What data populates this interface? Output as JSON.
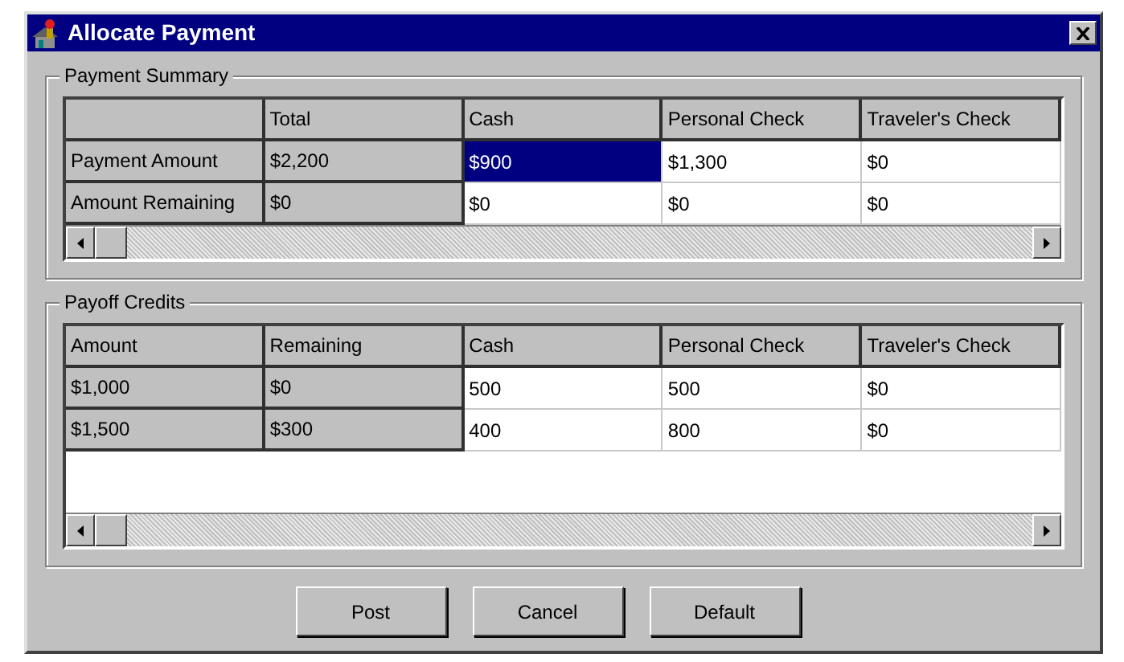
{
  "window": {
    "title": "Allocate Payment"
  },
  "payment_summary": {
    "title": "Payment Summary",
    "columns": [
      "",
      "Total",
      "Cash",
      "Personal Check",
      "Traveler's Check"
    ],
    "rows": [
      {
        "cells": [
          {
            "text": "Payment Amount",
            "kind": "fixed",
            "selected": false
          },
          {
            "text": "$2,200",
            "kind": "fixed",
            "selected": false
          },
          {
            "text": "$900",
            "kind": "edit",
            "selected": true
          },
          {
            "text": "$1,300",
            "kind": "edit",
            "selected": false
          },
          {
            "text": "$0",
            "kind": "edit",
            "selected": false
          }
        ]
      },
      {
        "cells": [
          {
            "text": "Amount Remaining",
            "kind": "fixed",
            "selected": false
          },
          {
            "text": "$0",
            "kind": "fixed",
            "selected": false
          },
          {
            "text": "$0",
            "kind": "edit",
            "selected": false
          },
          {
            "text": "$0",
            "kind": "edit",
            "selected": false
          },
          {
            "text": "$0",
            "kind": "edit",
            "selected": false
          }
        ]
      }
    ]
  },
  "payoff_credits": {
    "title": "Payoff Credits",
    "columns": [
      "Amount",
      "Remaining",
      "Cash",
      "Personal Check",
      "Traveler's Check"
    ],
    "rows": [
      {
        "cells": [
          {
            "text": "$1,000",
            "kind": "fixed",
            "selected": false
          },
          {
            "text": "$0",
            "kind": "fixed",
            "selected": false
          },
          {
            "text": "500",
            "kind": "edit",
            "selected": false
          },
          {
            "text": "500",
            "kind": "edit",
            "selected": false
          },
          {
            "text": "$0",
            "kind": "edit",
            "selected": false
          }
        ]
      },
      {
        "cells": [
          {
            "text": "$1,500",
            "kind": "fixed",
            "selected": false
          },
          {
            "text": "$300",
            "kind": "fixed",
            "selected": false
          },
          {
            "text": "400",
            "kind": "edit",
            "selected": false
          },
          {
            "text": "800",
            "kind": "edit",
            "selected": false
          },
          {
            "text": "$0",
            "kind": "edit",
            "selected": false
          }
        ]
      }
    ]
  },
  "buttons": [
    "Post",
    "Cancel",
    "Default"
  ]
}
